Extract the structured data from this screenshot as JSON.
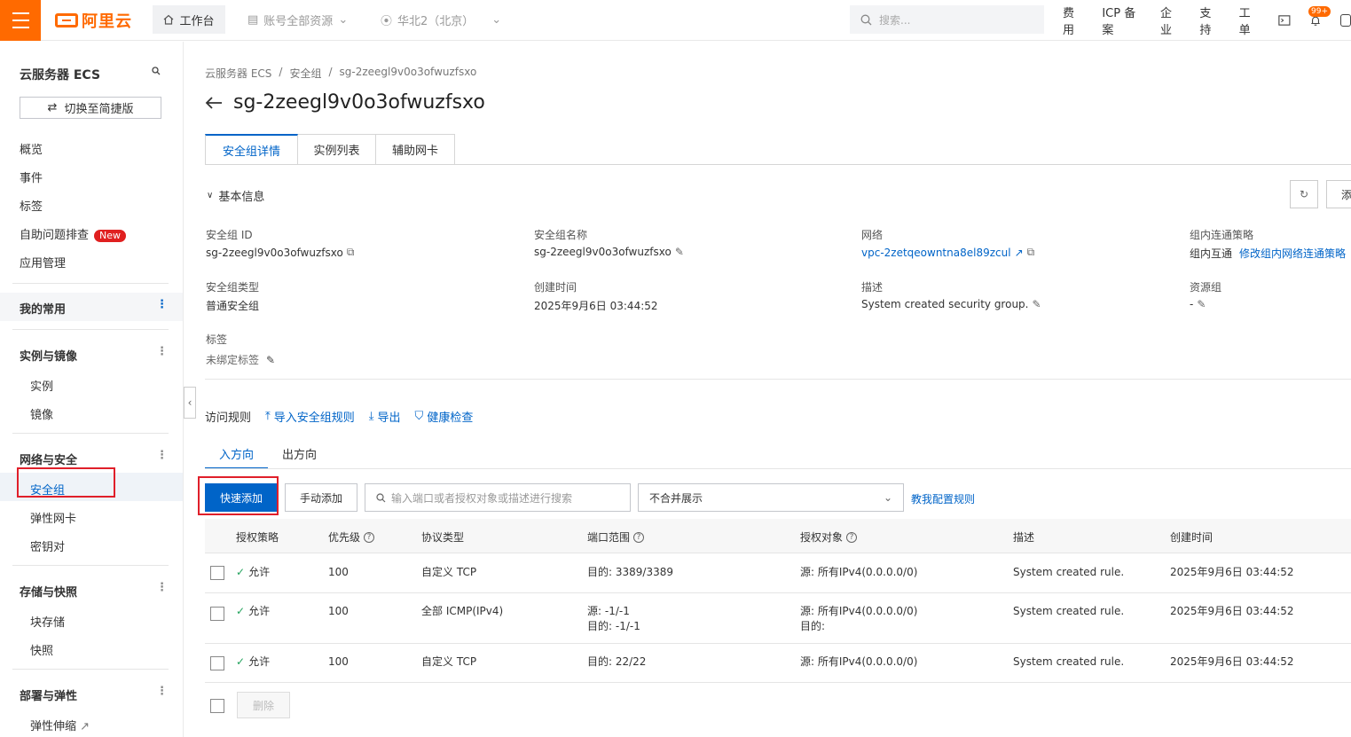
{
  "topbar": {
    "brand": "阿里云",
    "workbench": "工作台",
    "resource_scope": "账号全部资源",
    "region": "华北2（北京）",
    "search_placeholder": "搜索...",
    "links": [
      "费用",
      "ICP 备案",
      "企业",
      "支持",
      "工单"
    ],
    "notification_count": "99+",
    "accent_color": "#ff6a00"
  },
  "sidebar": {
    "title": "云服务器 ECS",
    "switch_label": "切换至简捷版",
    "top_items": [
      "概览",
      "事件",
      "标签",
      "自助问题排查",
      "应用管理"
    ],
    "new_badge": "New",
    "mine_label": "我的常用",
    "groups": [
      {
        "label": "实例与镜像",
        "items": [
          "实例",
          "镜像"
        ]
      },
      {
        "label": "网络与安全",
        "items": [
          "安全组",
          "弹性网卡",
          "密钥对"
        ]
      },
      {
        "label": "存储与快照",
        "items": [
          "块存储",
          "快照"
        ]
      },
      {
        "label": "部署与弹性",
        "items": [
          "弹性伸缩"
        ]
      }
    ]
  },
  "main": {
    "breadcrumb": [
      "云服务器 ECS",
      "安全组",
      "sg-2zeegl9v0o3ofwuzfsxo"
    ],
    "title": "sg-2zeegl9v0o3ofwuzfsxo",
    "tabs": [
      "安全组详情",
      "实例列表",
      "辅助网卡"
    ],
    "section_title": "基本信息",
    "add_button_partial": "添",
    "fields": {
      "sg_id_label": "安全组 ID",
      "sg_id": "sg-2zeegl9v0o3ofwuzfsxo",
      "sg_name_label": "安全组名称",
      "sg_name": "sg-2zeegl9v0o3ofwuzfsxo",
      "network_label": "网络",
      "network": "vpc-2zetqeowntna8el89zcul",
      "intra_policy_label": "组内连通策略",
      "intra_policy": "组内互通",
      "intra_policy_link": "修改组内网络连通策略",
      "sg_type_label": "安全组类型",
      "sg_type": "普通安全组",
      "created_label": "创建时间",
      "created": "2025年9月6日 03:44:52",
      "desc_label": "描述",
      "desc": "System created security group.",
      "rg_label": "资源组",
      "rg": "-",
      "tags_label": "标签",
      "tags": "未绑定标签"
    },
    "rules": {
      "title": "访问规则",
      "actions": [
        "导入安全组规则",
        "导出",
        "健康检查"
      ],
      "direction_tabs": [
        "入方向",
        "出方向"
      ],
      "quick_add": "快速添加",
      "manual_add": "手动添加",
      "search_placeholder": "输入端口或者授权对象或描述进行搜索",
      "merge_select": "不合并展示",
      "help_link": "教我配置规则",
      "columns": [
        "授权策略",
        "优先级",
        "协议类型",
        "端口范围",
        "授权对象",
        "描述",
        "创建时间"
      ],
      "rows": [
        {
          "policy": "允许",
          "priority": "100",
          "protocol": "自定义 TCP",
          "port": [
            "目的: 3389/3389"
          ],
          "target": [
            "源: 所有IPv4(0.0.0.0/0)"
          ],
          "desc": "System created rule.",
          "time": "2025年9月6日 03:44:52"
        },
        {
          "policy": "允许",
          "priority": "100",
          "protocol": "全部 ICMP(IPv4)",
          "port": [
            "源: -1/-1",
            "目的: -1/-1"
          ],
          "target": [
            "源: 所有IPv4(0.0.0.0/0)",
            "目的:"
          ],
          "desc": "System created rule.",
          "time": "2025年9月6日 03:44:52"
        },
        {
          "policy": "允许",
          "priority": "100",
          "protocol": "自定义 TCP",
          "port": [
            "目的: 22/22"
          ],
          "target": [
            "源: 所有IPv4(0.0.0.0/0)"
          ],
          "desc": "System created rule.",
          "time": "2025年9月6日 03:44:52"
        }
      ],
      "delete_label": "删除"
    }
  }
}
